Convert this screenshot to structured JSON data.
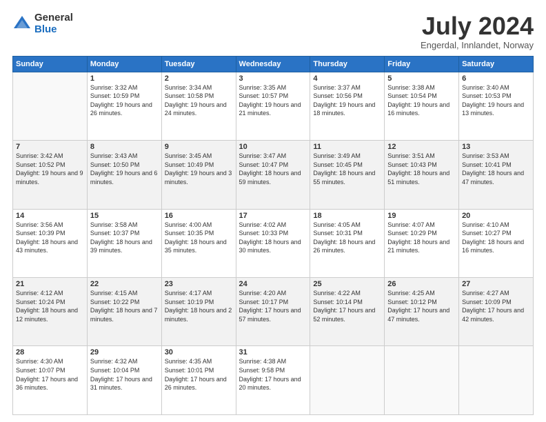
{
  "logo": {
    "general": "General",
    "blue": "Blue"
  },
  "header": {
    "title": "July 2024",
    "subtitle": "Engerdal, Innlandet, Norway"
  },
  "weekdays": [
    "Sunday",
    "Monday",
    "Tuesday",
    "Wednesday",
    "Thursday",
    "Friday",
    "Saturday"
  ],
  "weeks": [
    [
      {
        "day": "",
        "info": ""
      },
      {
        "day": "1",
        "info": "Sunrise: 3:32 AM\nSunset: 10:59 PM\nDaylight: 19 hours and 26 minutes."
      },
      {
        "day": "2",
        "info": "Sunrise: 3:34 AM\nSunset: 10:58 PM\nDaylight: 19 hours and 24 minutes."
      },
      {
        "day": "3",
        "info": "Sunrise: 3:35 AM\nSunset: 10:57 PM\nDaylight: 19 hours and 21 minutes."
      },
      {
        "day": "4",
        "info": "Sunrise: 3:37 AM\nSunset: 10:56 PM\nDaylight: 19 hours and 18 minutes."
      },
      {
        "day": "5",
        "info": "Sunrise: 3:38 AM\nSunset: 10:54 PM\nDaylight: 19 hours and 16 minutes."
      },
      {
        "day": "6",
        "info": "Sunrise: 3:40 AM\nSunset: 10:53 PM\nDaylight: 19 hours and 13 minutes."
      }
    ],
    [
      {
        "day": "7",
        "info": "Sunrise: 3:42 AM\nSunset: 10:52 PM\nDaylight: 19 hours and 9 minutes."
      },
      {
        "day": "8",
        "info": "Sunrise: 3:43 AM\nSunset: 10:50 PM\nDaylight: 19 hours and 6 minutes."
      },
      {
        "day": "9",
        "info": "Sunrise: 3:45 AM\nSunset: 10:49 PM\nDaylight: 19 hours and 3 minutes."
      },
      {
        "day": "10",
        "info": "Sunrise: 3:47 AM\nSunset: 10:47 PM\nDaylight: 18 hours and 59 minutes."
      },
      {
        "day": "11",
        "info": "Sunrise: 3:49 AM\nSunset: 10:45 PM\nDaylight: 18 hours and 55 minutes."
      },
      {
        "day": "12",
        "info": "Sunrise: 3:51 AM\nSunset: 10:43 PM\nDaylight: 18 hours and 51 minutes."
      },
      {
        "day": "13",
        "info": "Sunrise: 3:53 AM\nSunset: 10:41 PM\nDaylight: 18 hours and 47 minutes."
      }
    ],
    [
      {
        "day": "14",
        "info": "Sunrise: 3:56 AM\nSunset: 10:39 PM\nDaylight: 18 hours and 43 minutes."
      },
      {
        "day": "15",
        "info": "Sunrise: 3:58 AM\nSunset: 10:37 PM\nDaylight: 18 hours and 39 minutes."
      },
      {
        "day": "16",
        "info": "Sunrise: 4:00 AM\nSunset: 10:35 PM\nDaylight: 18 hours and 35 minutes."
      },
      {
        "day": "17",
        "info": "Sunrise: 4:02 AM\nSunset: 10:33 PM\nDaylight: 18 hours and 30 minutes."
      },
      {
        "day": "18",
        "info": "Sunrise: 4:05 AM\nSunset: 10:31 PM\nDaylight: 18 hours and 26 minutes."
      },
      {
        "day": "19",
        "info": "Sunrise: 4:07 AM\nSunset: 10:29 PM\nDaylight: 18 hours and 21 minutes."
      },
      {
        "day": "20",
        "info": "Sunrise: 4:10 AM\nSunset: 10:27 PM\nDaylight: 18 hours and 16 minutes."
      }
    ],
    [
      {
        "day": "21",
        "info": "Sunrise: 4:12 AM\nSunset: 10:24 PM\nDaylight: 18 hours and 12 minutes."
      },
      {
        "day": "22",
        "info": "Sunrise: 4:15 AM\nSunset: 10:22 PM\nDaylight: 18 hours and 7 minutes."
      },
      {
        "day": "23",
        "info": "Sunrise: 4:17 AM\nSunset: 10:19 PM\nDaylight: 18 hours and 2 minutes."
      },
      {
        "day": "24",
        "info": "Sunrise: 4:20 AM\nSunset: 10:17 PM\nDaylight: 17 hours and 57 minutes."
      },
      {
        "day": "25",
        "info": "Sunrise: 4:22 AM\nSunset: 10:14 PM\nDaylight: 17 hours and 52 minutes."
      },
      {
        "day": "26",
        "info": "Sunrise: 4:25 AM\nSunset: 10:12 PM\nDaylight: 17 hours and 47 minutes."
      },
      {
        "day": "27",
        "info": "Sunrise: 4:27 AM\nSunset: 10:09 PM\nDaylight: 17 hours and 42 minutes."
      }
    ],
    [
      {
        "day": "28",
        "info": "Sunrise: 4:30 AM\nSunset: 10:07 PM\nDaylight: 17 hours and 36 minutes."
      },
      {
        "day": "29",
        "info": "Sunrise: 4:32 AM\nSunset: 10:04 PM\nDaylight: 17 hours and 31 minutes."
      },
      {
        "day": "30",
        "info": "Sunrise: 4:35 AM\nSunset: 10:01 PM\nDaylight: 17 hours and 26 minutes."
      },
      {
        "day": "31",
        "info": "Sunrise: 4:38 AM\nSunset: 9:58 PM\nDaylight: 17 hours and 20 minutes."
      },
      {
        "day": "",
        "info": ""
      },
      {
        "day": "",
        "info": ""
      },
      {
        "day": "",
        "info": ""
      }
    ]
  ]
}
